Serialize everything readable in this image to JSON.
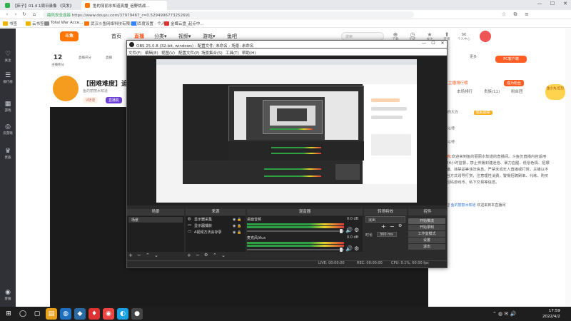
{
  "browser": {
    "tabs": [
      {
        "label": "【床子】01.4.1周日录像 《突发》",
        "active": false,
        "color": "#2fb24c"
      },
      {
        "label": "鱼的丽丽水知道真播_追野挑战...",
        "active": true,
        "color": "#ff7500"
      }
    ],
    "url": "https://www.douyu.com/37979467_r=0.5294996773252691",
    "url_prefix": "鼎风安全连接",
    "window_controls": [
      "—",
      "☐",
      "✕"
    ],
    "bookmarks": [
      {
        "label": "书签",
        "color": "#f0b400"
      },
      {
        "label": "云书签",
        "color": "#f0b400"
      },
      {
        "label": "Total War Acce...",
        "color": "#888"
      },
      {
        "label": "武汉斗鱼网络科技有限公司",
        "color": "#ff7500"
      },
      {
        "label": "百度设置 · 个人...",
        "color": "#3385ff"
      },
      {
        "label": "金蝶云盘_起点中...",
        "color": "#d33"
      }
    ]
  },
  "sidebar": {
    "items": [
      {
        "icon": "♡",
        "label": "关注"
      },
      {
        "icon": "☰",
        "label": "排行榜"
      },
      {
        "icon": "▦",
        "label": "游戏"
      },
      {
        "icon": "◎",
        "label": "云游戏"
      },
      {
        "icon": "♛",
        "label": "贵族"
      },
      {
        "icon": "◉",
        "label": "客服"
      }
    ]
  },
  "douyu": {
    "logo": "斗鱼",
    "nav": [
      {
        "label": "首页",
        "active": false
      },
      {
        "label": "直播",
        "active": true
      },
      {
        "label": "分类▾",
        "active": false
      },
      {
        "label": "视频▾",
        "active": false
      },
      {
        "label": "游戏▾",
        "active": false
      },
      {
        "label": "鱼吧",
        "active": false
      }
    ],
    "search_placeholder": "搜索",
    "header_icons": [
      {
        "glyph": "⊕",
        "label": "下载"
      },
      {
        "glyph": "◷",
        "label": "历史"
      },
      {
        "glyph": "★",
        "label": "关注"
      },
      {
        "glyph": "⬆",
        "label": "开播"
      },
      {
        "glyph": "✉",
        "label": "个人中心"
      }
    ],
    "stats": [
      {
        "value": "12",
        "label": "主播积分"
      },
      {
        "value": "",
        "label": "直播开分"
      },
      {
        "value": "",
        "label": "直播"
      }
    ],
    "more_label": "更多",
    "pc_button": "PC客户端",
    "room_title": "【困难难度】追野",
    "room_owner": "鱼的丽丽水知道",
    "room_tags": [
      "V随便",
      "直播机"
    ],
    "right_tabs": [
      {
        "label": "主播排行榜",
        "active": true
      },
      {
        "label": "本场排行",
        "active": false
      },
      {
        "label": "贵族(11)",
        "active": false
      },
      {
        "label": "粉丝团",
        "active": false
      }
    ],
    "ranks": [
      {
        "name": "大山的大方",
        "badge": "成就勋章"
      },
      {
        "name": "虚位以待",
        "badge": ""
      },
      {
        "name": "虚位以待",
        "badge": ""
      }
    ],
    "fan_link": "成为粉丝",
    "notice_label": "提示:",
    "notice_text": "欢迎来到鱼的丽丽水知道的直播间。斗鱼仍直播内容适用于24小时监督，禁止传播封建迷信、暴力血腥、低俗色情、招嫖诈骗、违禁品等违法信息。严禁未成年人直播或打赏。主播以不正当方式诱导打赏，注意理性消费，警惕招聘刷单、代练、购买礼包码游戏币、私下交易等信息。",
    "welcome_prefix": "欢迎",
    "welcome_name": "鱼的丽丽水知道",
    "welcome_suffix": "欢迎来到本直播间",
    "gift_label": "鱼小丸 红包"
  },
  "obs": {
    "title": "OBS 25.0.8 (32-bit, windows) - 配置文件: 未命名 - 场景: 未命名",
    "menu": [
      "文件(F)",
      "编辑(E)",
      "视图(V)",
      "配置文件(P)",
      "场景集合(S)",
      "工具(T)",
      "帮助(H)"
    ],
    "docks": {
      "scenes_title": "场景",
      "sources_title": "来源",
      "mixer_title": "混音器",
      "transitions_title": "转场特效",
      "controls_title": "控件"
    },
    "scenes": [
      "场景"
    ],
    "sources": [
      {
        "icon": "◍",
        "label": "显示器采集"
      },
      {
        "icon": "▭",
        "label": "显示器捕获"
      },
      {
        "icon": "▭",
        "label": "A视频方法会存录"
      }
    ],
    "mixer": [
      {
        "label": "桌面音频",
        "db": "0.0 dB"
      },
      {
        "label": "麦克风/Aux",
        "db": "0.0 dB"
      }
    ],
    "transition": "淡出",
    "duration_label": "时长",
    "duration_value": "300 ms",
    "controls": [
      "开始推流",
      "开始录制",
      "工作室模式",
      "设置",
      "退出"
    ],
    "status": {
      "live": "LIVE: 00:00:00",
      "rec": "REC: 00:00:00",
      "cpu": "CPU: 0.1%, 60.00 fps"
    }
  },
  "taskbar": {
    "apps": [
      {
        "glyph": "⊞",
        "color": "#1e1e1e"
      },
      {
        "glyph": "◯",
        "color": "#1e1e1e"
      },
      {
        "glyph": "▢",
        "color": "#1e1e1e"
      },
      {
        "glyph": "▤",
        "color": "#e7a11c"
      },
      {
        "glyph": "◍",
        "color": "#1f6fc1"
      },
      {
        "glyph": "◆",
        "color": "#2b6aa0"
      },
      {
        "glyph": "♦",
        "color": "#d33"
      },
      {
        "glyph": "◉",
        "color": "#e44"
      },
      {
        "glyph": "◐",
        "color": "#1ba1e2"
      },
      {
        "glyph": "●",
        "color": "#444"
      }
    ],
    "time": "17:59",
    "date": "2022/4/2"
  }
}
